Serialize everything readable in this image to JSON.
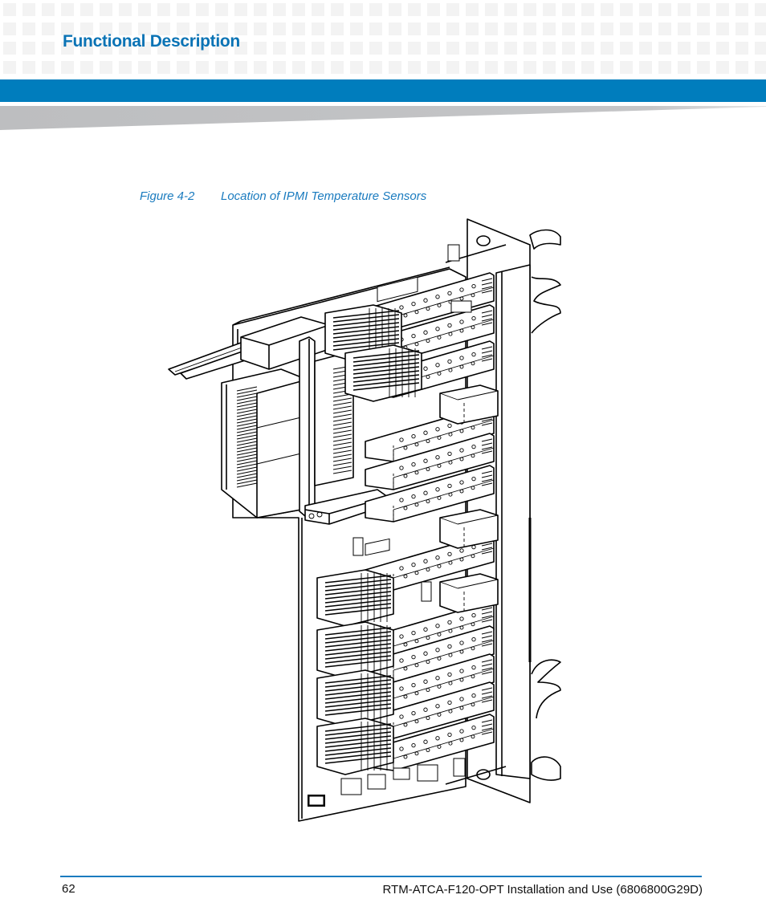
{
  "header": {
    "chapter_title": "Functional Description",
    "colors": {
      "accent_blue": "#007dbd",
      "title_blue": "#0a73b5",
      "grid_square": "#f3f3f3",
      "wedge_gray": "#bdbec0"
    }
  },
  "figure": {
    "number": "Figure 4-2",
    "title": "Location of IPMI Temperature Sensors",
    "illustration": "isometric-line-drawing-rtm-board",
    "components": {
      "sfp_cage_count": 12,
      "heatsink_count": 6,
      "sensor_block_count": 3
    }
  },
  "footer": {
    "page_number": "62",
    "document_title": "RTM-ATCA-F120-OPT Installation and Use (6806800G29D)"
  }
}
